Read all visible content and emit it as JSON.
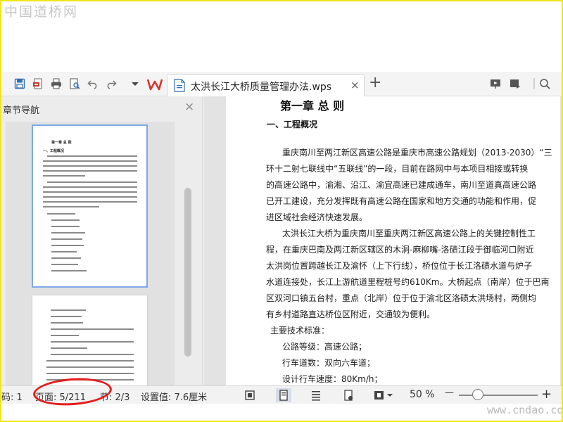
{
  "watermarks": {
    "top": "中国道桥网",
    "bottom": "www.cndao.com"
  },
  "colors": {
    "accent_blue": "#7ea8e8",
    "wps_red": "#d8352a",
    "annotation_red": "#e51c1c",
    "frame_yellow": "#f2e418"
  },
  "toolbar": {
    "tab_title": "太洪长江大桥质量管理办法.wps",
    "tab_close": "×",
    "tab_add": "+",
    "icons": [
      "save-icon",
      "export-pdf-icon",
      "print-icon",
      "print-preview-icon",
      "undo-icon",
      "redo-icon",
      "dropdown-icon",
      "wps-logo-icon",
      "document-icon",
      "present-icon",
      "bookmark-icon",
      "search-icon"
    ]
  },
  "nav_panel": {
    "title": "章节导航",
    "close": "×",
    "thumb1_chapter": "第一章  总  则",
    "thumb1_section": "一、工程概况"
  },
  "document": {
    "chapter_title": "第一章   总   则",
    "section_title": "一、工程概况",
    "lines": [
      "重庆南川至两江新区高速公路是重庆市高速公路规划（2013-2030）“三",
      "环十二射七联线中“五联线”的一段，目前在路网中与本项目相接或转换",
      "的高速公路中，渝湘、沿江、渝宜高速已建成通车，南川至道真高速公路",
      "已开工建设，充分发挥既有高速公路在国家和地方交通的功能和作用，促",
      "进区域社会经济快速发展。",
      "太洪长江大桥为重庆南川至重庆两江新区高速公路上的关键控制性工",
      "程，在重庆巴南及两江新区辖区的木洞-麻柳嘴-洛碛江段于御临河口附近",
      "太洪岗位置跨越长江及渝怀（上下行线），桥位位于长江洛碛水道与炉子",
      "水道连接处，长江上游航道里程桩号约610Km。大桥起点（南岸）位于巴南",
      "区双河口镇五台村，重点（北岸）位于位于渝北区洛碛太洪场村，两侧均",
      "有乡村道路直达桥位区附近，交通较为便利。",
      "主要技术标准：",
      "公路等级：高速公路；",
      "行车道数：双向六车道；",
      "设计行车速度：80Km/h；"
    ]
  },
  "statusbar": {
    "page_code": "码: 1",
    "page_num": "页面: 5/211",
    "section": "节: 2/3",
    "setting": "设置值: 7.6厘米",
    "zoom": "50 %",
    "zoom_fraction": 0.24,
    "zoom_minus": "—",
    "zoom_plus": "+"
  }
}
